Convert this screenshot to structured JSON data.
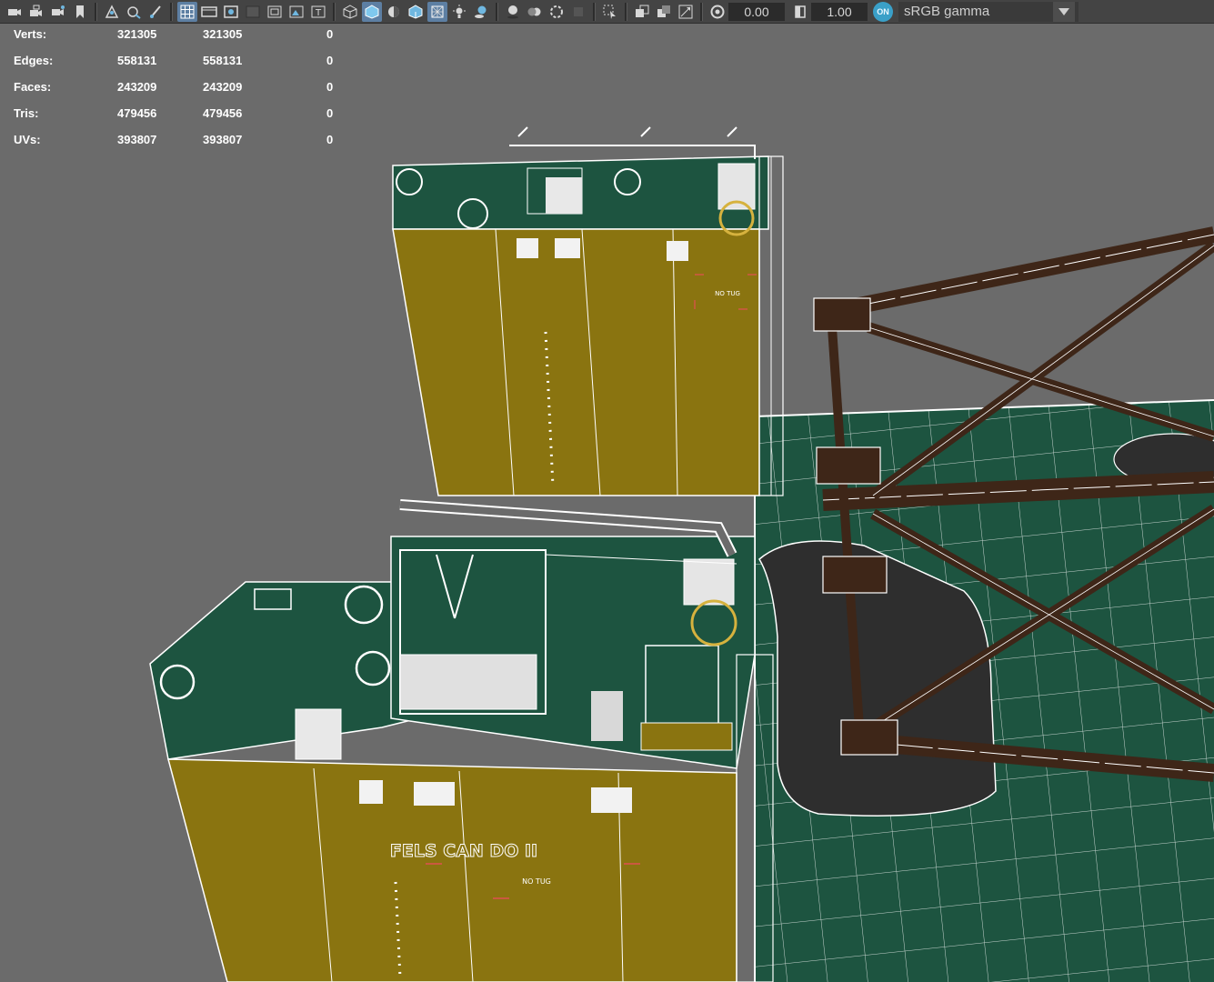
{
  "toolbar": {
    "left_icons": [
      "camera-icon",
      "camera-lock-icon",
      "camera-attributes-icon",
      "bookmark-icon",
      "image-plane-icon",
      "grease-pencil-icon",
      "paint-icon"
    ],
    "display_icons": [
      "grid-icon",
      "film-gate-icon",
      "resolution-gate-icon",
      "gate-mask-icon",
      "field-chart-icon",
      "safe-action-icon",
      "safe-title-icon"
    ],
    "shading_icons": [
      "wireframe-icon",
      "smooth-shade-icon",
      "default-material-icon",
      "wireframe-on-shaded-icon",
      "xray-icon",
      "lights-icon",
      "shadows-icon"
    ],
    "render_icons": [
      "ambient-occlusion-icon",
      "motion-blur-icon",
      "anti-aliasing-icon",
      "depth-of-field-icon"
    ],
    "isolate_icons": [
      "isolate-select-icon",
      "xray-active-icon",
      "xray-joints-icon",
      "backface-culling-icon"
    ],
    "exposure_value": "0.00",
    "gamma_value": "1.00",
    "color_management_badge": "ON",
    "color_space": "sRGB gamma"
  },
  "hud": {
    "rows": [
      {
        "label": "Verts:",
        "c1": "321305",
        "c2": "321305",
        "c3": "0"
      },
      {
        "label": "Edges:",
        "c1": "558131",
        "c2": "558131",
        "c3": "0"
      },
      {
        "label": "Faces:",
        "c1": "243209",
        "c2": "243209",
        "c3": "0"
      },
      {
        "label": "Tris:",
        "c1": "479456",
        "c2": "479456",
        "c3": "0"
      },
      {
        "label": "UVs:",
        "c1": "393807",
        "c2": "393807",
        "c3": "0"
      }
    ]
  },
  "scene": {
    "hull_text": "FELS CAN DO II",
    "sign_upper": "NO TUG",
    "sign_lower": "NO TUG",
    "colors": {
      "background": "#6b6b6b",
      "deck_green": "#1d5440",
      "hull_yellow": "#8a7410",
      "leg_brown": "#3e2618",
      "wire": "#ffffff",
      "pad_dark": "#2e2e2e"
    }
  }
}
